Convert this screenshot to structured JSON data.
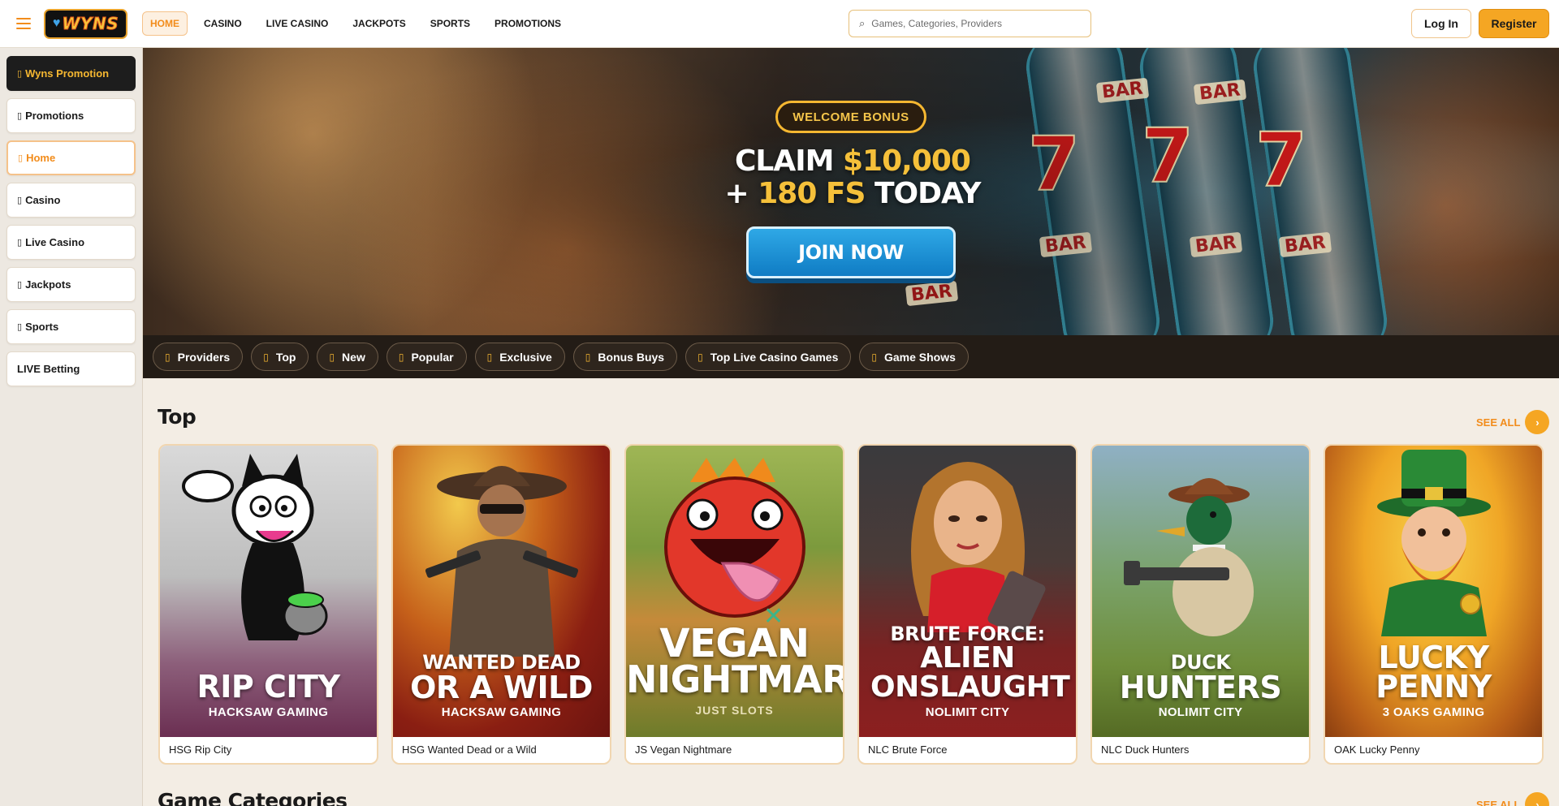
{
  "header": {
    "logo_text": "WYNS",
    "nav": [
      "HOME",
      "CASINO",
      "LIVE CASINO",
      "JACKPOTS",
      "SPORTS",
      "PROMOTIONS"
    ],
    "active_nav": "HOME",
    "search_placeholder": "Games, Categories, Providers",
    "login_label": "Log In",
    "register_label": "Register"
  },
  "sidebar": {
    "items": [
      {
        "label": "Wyns Promotion",
        "icon": "gift-icon"
      },
      {
        "label": "Promotions",
        "icon": "tag-icon"
      },
      {
        "label": "Home",
        "icon": "home-icon"
      },
      {
        "label": "Casino",
        "icon": "slot-icon"
      },
      {
        "label": "Live Casino",
        "icon": "cards-icon"
      },
      {
        "label": "Jackpots",
        "icon": "trophy-icon"
      },
      {
        "label": "Sports",
        "icon": "ball-icon"
      },
      {
        "label": "LIVE Betting",
        "icon": ""
      }
    ]
  },
  "hero": {
    "badge": "WELCOME BONUS",
    "claim_line1_white": "CLAIM ",
    "claim_line1_gold": "$10,000",
    "claim_line2_white1": "+ ",
    "claim_line2_gold": "180 FS",
    "claim_line2_white2": " TODAY",
    "cta": "JOIN NOW"
  },
  "filters": [
    "Providers",
    "Top",
    "New",
    "Popular",
    "Exclusive",
    "Bonus Buys",
    "Top Live Casino Games",
    "Game Shows"
  ],
  "top_section": {
    "title": "Top",
    "see_all": "SEE ALL",
    "cards": [
      {
        "title1": "RIP CITY",
        "title2": "",
        "provider": "HACKSAW GAMING",
        "label": "HSG Rip City"
      },
      {
        "title1": "WANTED DEAD",
        "title2": "OR A WILD",
        "provider": "HACKSAW GAMING",
        "label": "HSG Wanted Dead or a Wild"
      },
      {
        "title1": "VEGAN",
        "title2": "NIGHTMARE",
        "provider": "JUST SLOTS",
        "label": "JS Vegan Nightmare"
      },
      {
        "title1": "BRUTE FORCE:",
        "title2": "ALIEN ONSLAUGHT",
        "provider": "NOLIMIT CITY",
        "label": "NLC Brute Force"
      },
      {
        "title1": "DUCK",
        "title2": "HUNTERS",
        "provider": "NOLIMIT CITY",
        "label": "NLC Duck Hunters"
      },
      {
        "title1": "LUCKY",
        "title2": "PENNY",
        "provider": "3 OAKS GAMING",
        "label": "OAK Lucky Penny"
      }
    ]
  },
  "categories_section": {
    "title": "Game Categories",
    "see_all": "SEE ALL"
  },
  "colors": {
    "accent": "#f28c1b",
    "register_bg": "#f5a623",
    "join_blue": "#1a8fd6",
    "filter_bar": "#231c16"
  }
}
